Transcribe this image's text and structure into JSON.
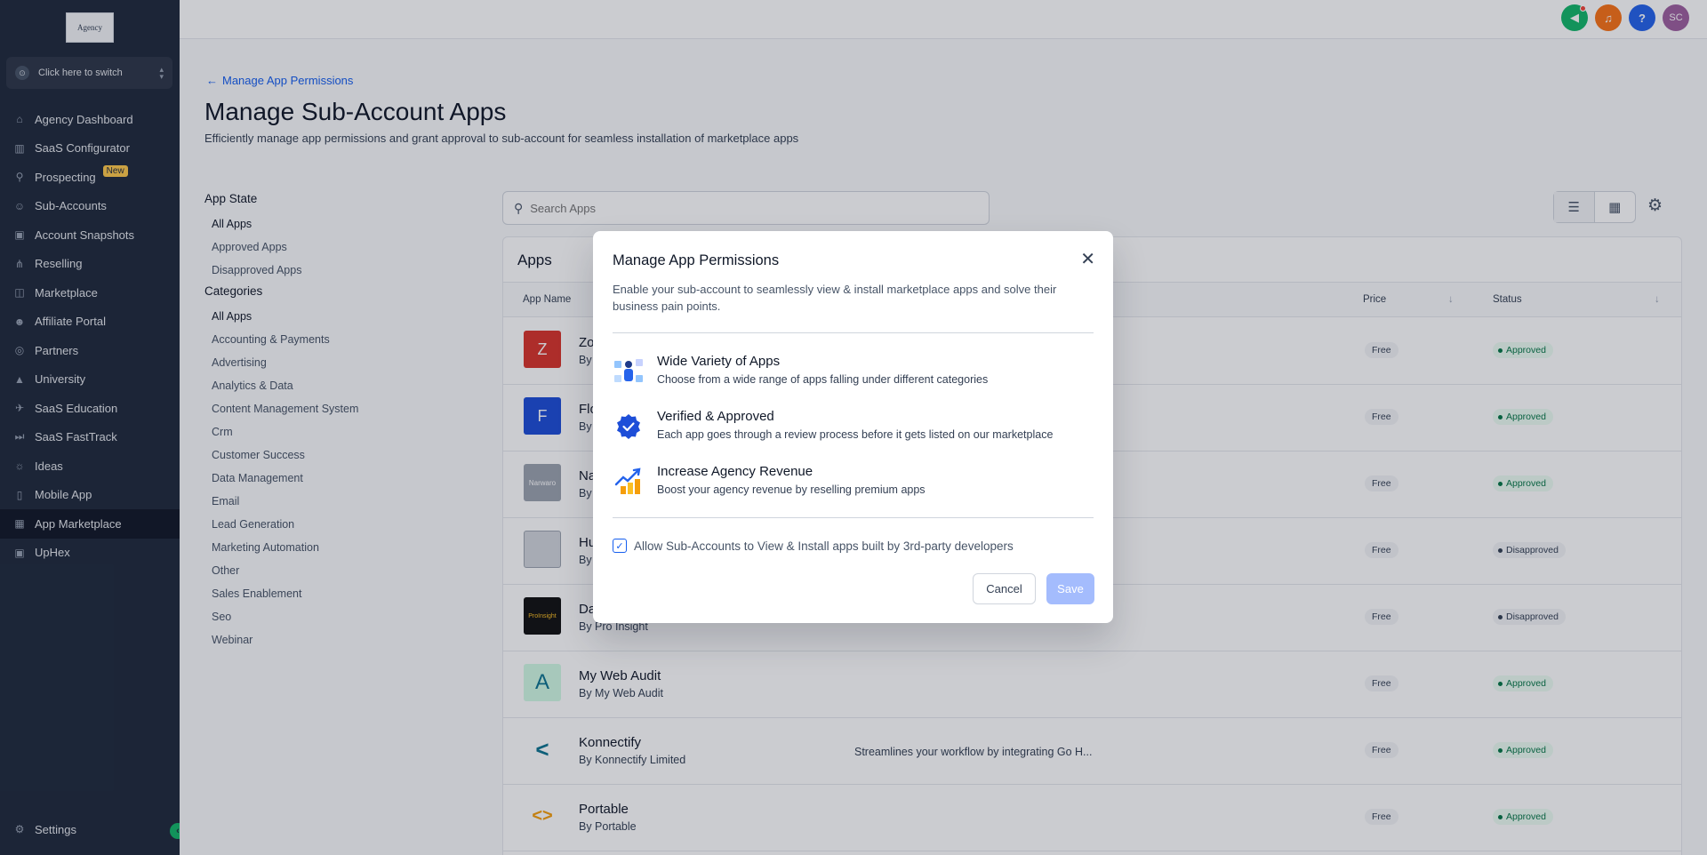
{
  "sidebar": {
    "logo_text": "Agency",
    "switcher_label": "Click here to switch",
    "items": [
      {
        "label": "Agency Dashboard",
        "icon": "home-icon"
      },
      {
        "label": "SaaS Configurator",
        "icon": "chart-icon"
      },
      {
        "label": "Prospecting",
        "icon": "user-search-icon",
        "badge": "New"
      },
      {
        "label": "Sub-Accounts",
        "icon": "user-icon"
      },
      {
        "label": "Account Snapshots",
        "icon": "image-icon"
      },
      {
        "label": "Reselling",
        "icon": "network-icon"
      },
      {
        "label": "Marketplace",
        "icon": "bag-icon"
      },
      {
        "label": "Affiliate Portal",
        "icon": "users-icon"
      },
      {
        "label": "Partners",
        "icon": "handshake-icon"
      },
      {
        "label": "University",
        "icon": "graduation-icon"
      },
      {
        "label": "SaaS Education",
        "icon": "rocket-icon"
      },
      {
        "label": "SaaS FastTrack",
        "icon": "fast-forward-icon"
      },
      {
        "label": "Ideas",
        "icon": "bulb-icon"
      },
      {
        "label": "Mobile App",
        "icon": "phone-icon"
      },
      {
        "label": "App Marketplace",
        "icon": "grid-icon",
        "active": true
      },
      {
        "label": "UpHex",
        "icon": "uphex-icon"
      }
    ],
    "settings_label": "Settings"
  },
  "topbar": {
    "avatar_initials": "SC"
  },
  "page": {
    "back_link": "Manage App Permissions",
    "title": "Manage Sub-Account Apps",
    "subtitle": "Efficiently manage app permissions and grant approval to sub-account for seamless installation of marketplace apps"
  },
  "filters": {
    "app_state_heading": "App State",
    "app_state": [
      "All Apps",
      "Approved Apps",
      "Disapproved Apps"
    ],
    "categories_heading": "Categories",
    "categories": [
      "All Apps",
      "Accounting & Payments",
      "Advertising",
      "Analytics & Data",
      "Content Management System",
      "Crm",
      "Customer Success",
      "Data Management",
      "Email",
      "Lead Generation",
      "Marketing Automation",
      "Other",
      "Sales Enablement",
      "Seo",
      "Webinar"
    ]
  },
  "search": {
    "placeholder": "Search Apps"
  },
  "apps": {
    "title": "Apps",
    "columns": {
      "name": "App Name",
      "price": "Price",
      "status": "Status"
    },
    "rows": [
      {
        "name": "Zo",
        "by": "By",
        "desc": "",
        "price": "Free",
        "status": "Approved",
        "logo_color": "#d9342b",
        "logo_text": "Z"
      },
      {
        "name": "Flo",
        "by": "By",
        "desc": "",
        "price": "Free",
        "status": "Approved",
        "logo_color": "#1d4ed8",
        "logo_text": "F"
      },
      {
        "name": "Na",
        "by": "By",
        "desc": "",
        "price": "Free",
        "status": "Approved",
        "logo_color": "#9ca3af",
        "logo_text": "Narwaro"
      },
      {
        "name": "Hu",
        "by": "By",
        "desc": "",
        "price": "Free",
        "status": "Disapproved",
        "logo_color": "#d1d5db",
        "logo_text": ""
      },
      {
        "name": "Da",
        "by": "By Pro Insight",
        "desc": "",
        "price": "Free",
        "status": "Disapproved",
        "logo_color": "#111111",
        "logo_text": "ProInsight"
      },
      {
        "name": "My Web Audit",
        "by": "By My Web Audit",
        "desc": "",
        "price": "Free",
        "status": "Approved",
        "logo_color": "#e0f2f1",
        "logo_text": "A"
      },
      {
        "name": "Konnectify",
        "by": "By Konnectify Limited",
        "desc": "Streamlines your workflow by integrating Go H...",
        "price": "Free",
        "status": "Approved",
        "logo_color": "#ffffff",
        "logo_text": "<"
      },
      {
        "name": "Portable",
        "by": "By Portable",
        "desc": "",
        "price": "Free",
        "status": "Approved",
        "logo_color": "#ffffff",
        "logo_text": "<>"
      }
    ]
  },
  "modal": {
    "title": "Manage App Permissions",
    "description": "Enable your sub-account to seamlessly view & install marketplace apps and solve their business pain points.",
    "features": [
      {
        "title": "Wide Variety of Apps",
        "text": "Choose from a wide range of apps falling under different categories"
      },
      {
        "title": "Verified & Approved",
        "text": "Each app goes through a review process before it gets listed on our marketplace"
      },
      {
        "title": "Increase Agency Revenue",
        "text": "Boost your agency revenue by reselling premium apps"
      }
    ],
    "checkbox_label": "Allow Sub-Accounts to View & Install apps built by 3rd-party developers",
    "cancel_label": "Cancel",
    "save_label": "Save"
  }
}
